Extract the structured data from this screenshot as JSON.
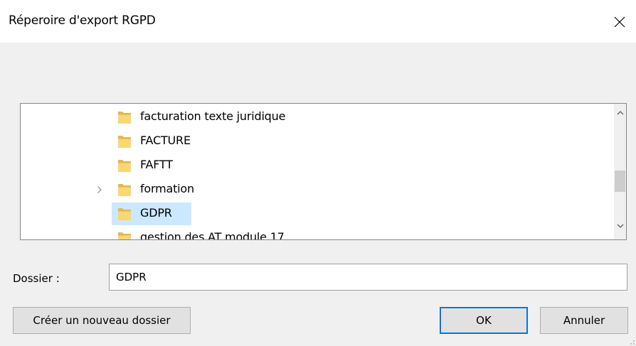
{
  "window": {
    "title": "Réperoire d'export RGPD",
    "close_icon": "close-icon"
  },
  "tree": {
    "items": [
      {
        "label": "facturation texte juridique",
        "expandable": false,
        "selected": false,
        "icon": "folder-icon"
      },
      {
        "label": "FACTURE",
        "expandable": false,
        "selected": false,
        "icon": "folder-icon"
      },
      {
        "label": "FAFTT",
        "expandable": false,
        "selected": false,
        "icon": "folder-icon"
      },
      {
        "label": "formation",
        "expandable": true,
        "selected": false,
        "icon": "folder-icon"
      },
      {
        "label": "GDPR",
        "expandable": false,
        "selected": true,
        "icon": "folder-icon"
      },
      {
        "label": "gestion des AT module 17",
        "expandable": false,
        "selected": false,
        "icon": "folder-icon"
      }
    ],
    "scroll_position": 0.53
  },
  "folder": {
    "label": "Dossier :",
    "value": "GDPR"
  },
  "buttons": {
    "new_folder": "Créer un nouveau dossier",
    "ok": "OK",
    "cancel": "Annuler"
  },
  "colors": {
    "selection": "#cce8ff",
    "folder": "#f8d775",
    "accent": "#0078d7"
  }
}
